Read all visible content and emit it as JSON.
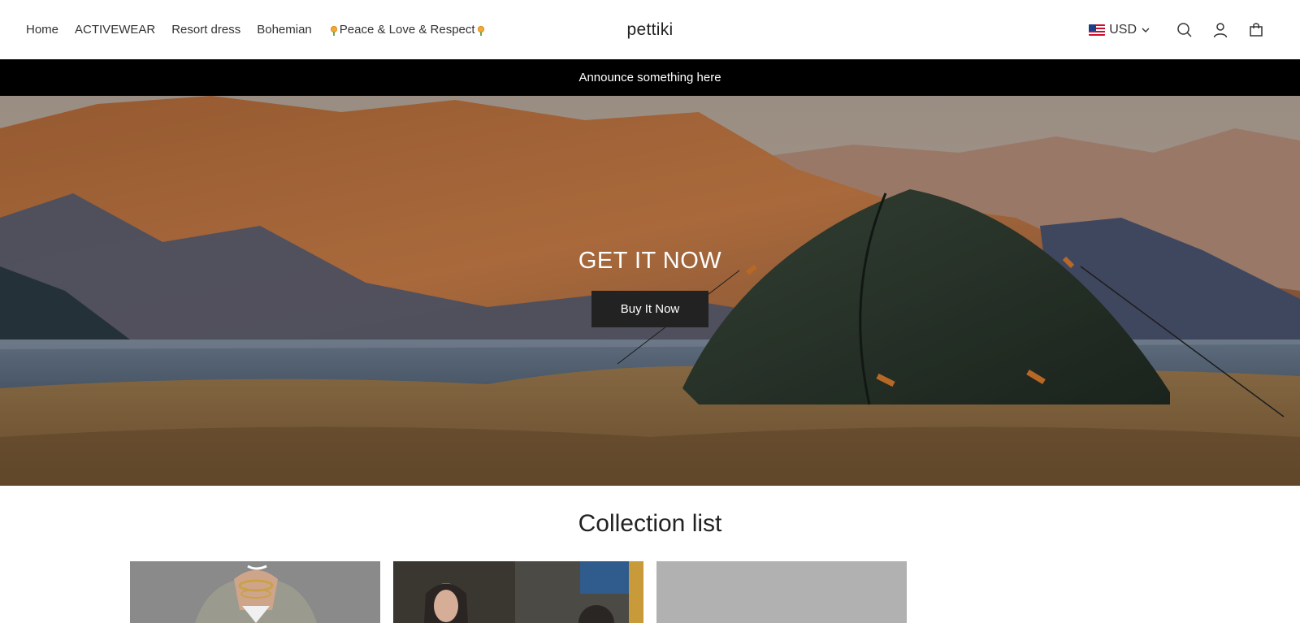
{
  "nav": {
    "items": [
      {
        "label": "Home"
      },
      {
        "label": "ACTIVEWEAR"
      },
      {
        "label": "Resort dress"
      },
      {
        "label": "Bohemian"
      },
      {
        "label": "Peace & Love & Respect"
      }
    ]
  },
  "brand": {
    "name": "pettiki"
  },
  "header": {
    "currency": "USD",
    "icons": [
      "search-icon",
      "account-icon",
      "cart-icon"
    ]
  },
  "announcement": {
    "text": "Announce something here"
  },
  "hero": {
    "title": "GET IT NOW",
    "button_label": "Buy It Now"
  },
  "collection": {
    "title": "Collection list"
  },
  "colors": {
    "announcement_bg": "#000000",
    "button_bg": "#222222",
    "placeholder": "#b1b1b1"
  }
}
